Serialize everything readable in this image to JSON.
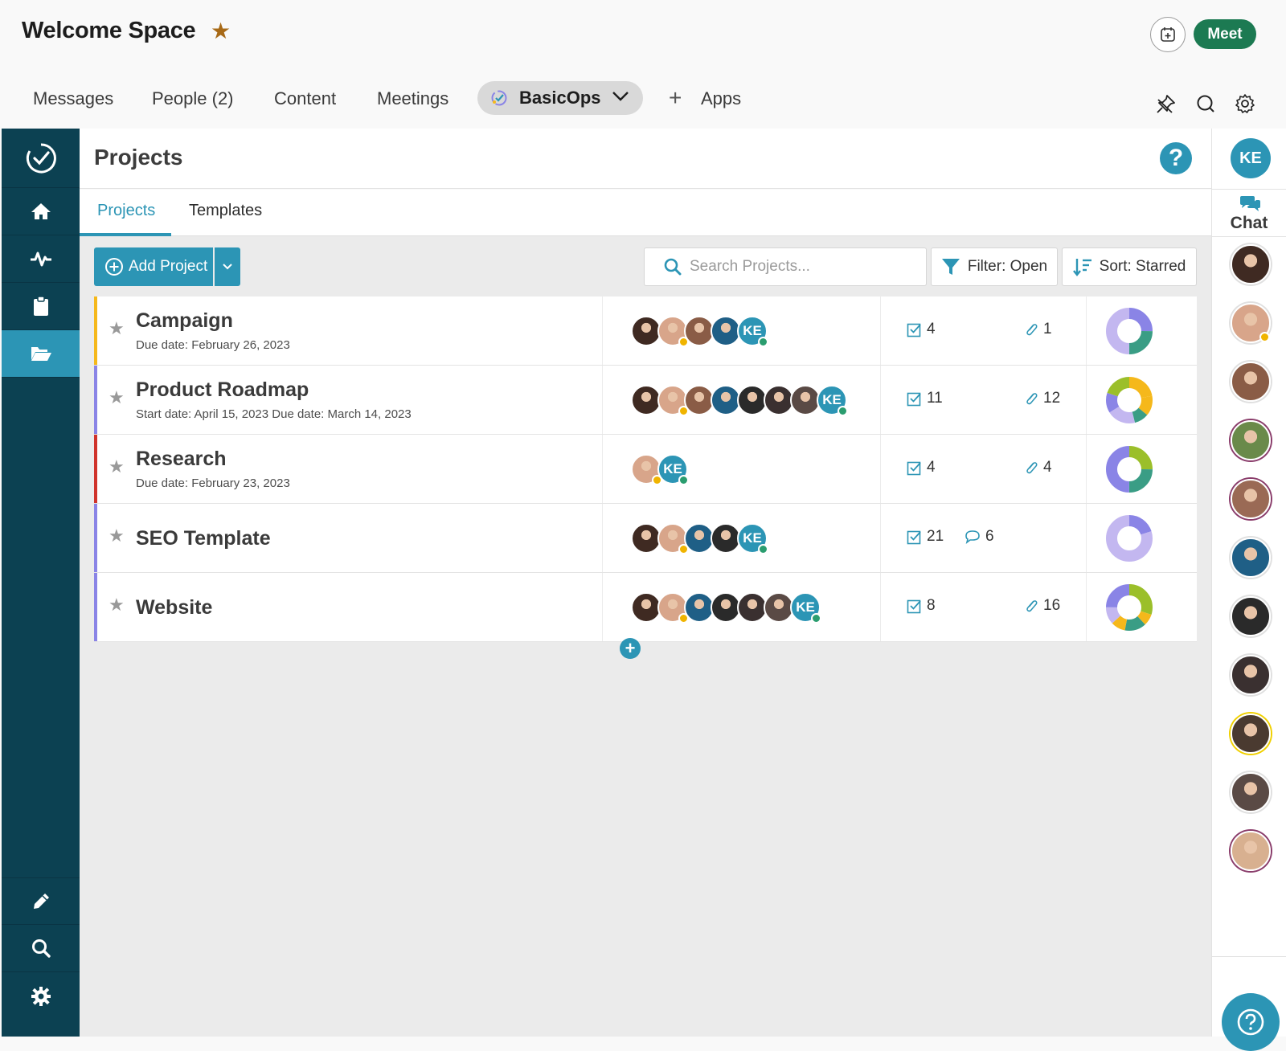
{
  "header": {
    "space_title": "Welcome Space",
    "meet_label": "Meet"
  },
  "nav": {
    "items": [
      "Messages",
      "People (2)",
      "Content",
      "Meetings"
    ],
    "active_app": "BasicOps",
    "apps_label": "Apps"
  },
  "main": {
    "title": "Projects",
    "tabs": [
      "Projects",
      "Templates"
    ],
    "active_tab": 0
  },
  "toolbar": {
    "add_label": "Add Project",
    "search_placeholder": "Search Projects...",
    "filter_label": "Filter: Open",
    "sort_label": "Sort: Starred"
  },
  "projects": [
    {
      "name": "Campaign",
      "date": "Due date: February 26, 2023",
      "accent": "#f5b81b",
      "members": [
        {
          "c": "#3f2a22",
          "s": "none"
        },
        {
          "c": "#d8a58a",
          "s": "away"
        },
        {
          "c": "#8a5c46",
          "s": "none"
        },
        {
          "c": "#1f5f86",
          "s": "none"
        },
        {
          "c": "ke",
          "s": "on"
        }
      ],
      "tasks": "4",
      "comments": "",
      "attachments": "1",
      "donut": [
        {
          "v": 0.25,
          "c": "#8a84e6"
        },
        {
          "v": 0.25,
          "c": "#3a9d85"
        },
        {
          "v": 0.5,
          "c": "#c3b7f0"
        }
      ]
    },
    {
      "name": "Product Roadmap",
      "date": "Start date: April 15, 2023 Due date: March 14, 2023",
      "accent": "#8a84e6",
      "members": [
        {
          "c": "#3f2a22",
          "s": "none"
        },
        {
          "c": "#d8a58a",
          "s": "away"
        },
        {
          "c": "#8a5c46",
          "s": "none"
        },
        {
          "c": "#1f5f86",
          "s": "none"
        },
        {
          "c": "#2a2a2a",
          "s": "none"
        },
        {
          "c": "#3a3030",
          "s": "none"
        },
        {
          "c": "#5a4a45",
          "s": "none"
        },
        {
          "c": "ke",
          "s": "on"
        }
      ],
      "tasks": "11",
      "comments": "",
      "attachments": "12",
      "donut": [
        {
          "v": 0.22,
          "c": "#f5b81b"
        },
        {
          "v": 0.14,
          "c": "#f5b81b"
        },
        {
          "v": 0.1,
          "c": "#3a9d85"
        },
        {
          "v": 0.2,
          "c": "#c3b7f0"
        },
        {
          "v": 0.14,
          "c": "#8a84e6"
        },
        {
          "v": 0.2,
          "c": "#9bbf2a"
        }
      ]
    },
    {
      "name": "Research",
      "date": "Due date: February 23, 2023",
      "accent": "#d0332b",
      "members": [
        {
          "c": "#d8a58a",
          "s": "away"
        },
        {
          "c": "ke",
          "s": "on"
        }
      ],
      "tasks": "4",
      "comments": "",
      "attachments": "4",
      "donut": [
        {
          "v": 0.25,
          "c": "#9bbf2a"
        },
        {
          "v": 0.25,
          "c": "#3a9d85"
        },
        {
          "v": 0.5,
          "c": "#8a84e6"
        }
      ]
    },
    {
      "name": "SEO Template",
      "date": "",
      "accent": "#8a84e6",
      "members": [
        {
          "c": "#3f2a22",
          "s": "none"
        },
        {
          "c": "#d8a58a",
          "s": "away"
        },
        {
          "c": "#1f5f86",
          "s": "none"
        },
        {
          "c": "#2a2a2a",
          "s": "none"
        },
        {
          "c": "ke",
          "s": "on"
        }
      ],
      "tasks": "21",
      "comments": "6",
      "attachments": "",
      "donut": [
        {
          "v": 0.2,
          "c": "#8a84e6"
        },
        {
          "v": 0.8,
          "c": "#c3b7f0"
        }
      ]
    },
    {
      "name": "Website",
      "date": "",
      "accent": "#8a84e6",
      "members": [
        {
          "c": "#3f2a22",
          "s": "none"
        },
        {
          "c": "#d8a58a",
          "s": "away"
        },
        {
          "c": "#1f5f86",
          "s": "none"
        },
        {
          "c": "#2a2a2a",
          "s": "none"
        },
        {
          "c": "#3a3030",
          "s": "none"
        },
        {
          "c": "#5a4a45",
          "s": "none"
        },
        {
          "c": "ke",
          "s": "on"
        }
      ],
      "tasks": "8",
      "comments": "",
      "attachments": "16",
      "donut": [
        {
          "v": 0.3,
          "c": "#9bbf2a"
        },
        {
          "v": 0.08,
          "c": "#f5b81b"
        },
        {
          "v": 0.15,
          "c": "#3a9d85"
        },
        {
          "v": 0.1,
          "c": "#f5b81b"
        },
        {
          "v": 0.12,
          "c": "#c3b7f0"
        },
        {
          "v": 0.25,
          "c": "#8a84e6"
        }
      ]
    }
  ],
  "user": {
    "initials": "KE"
  },
  "chat": {
    "label": "Chat",
    "contacts": [
      {
        "c": "#3f2a22",
        "ring": "#e0e0e0",
        "s": "none"
      },
      {
        "c": "#d8a58a",
        "ring": "#e0e0e0",
        "s": "away"
      },
      {
        "c": "#8a5c46",
        "ring": "#e0e0e0",
        "s": "none"
      },
      {
        "c": "#6a8a4a",
        "ring": "#8a3d6b",
        "s": "none"
      },
      {
        "c": "#9a6a55",
        "ring": "#8a3d6b",
        "s": "none"
      },
      {
        "c": "#1f5f86",
        "ring": "#e0e0e0",
        "s": "none"
      },
      {
        "c": "#2a2a2a",
        "ring": "#e0e0e0",
        "s": "none"
      },
      {
        "c": "#3a3030",
        "ring": "#e0e0e0",
        "s": "none"
      },
      {
        "c": "#4a3a30",
        "ring": "#f0d000",
        "s": "none"
      },
      {
        "c": "#5a4a45",
        "ring": "#e0e0e0",
        "s": "none"
      },
      {
        "c": "#d8b090",
        "ring": "#8a3d6b",
        "s": "none"
      }
    ]
  },
  "colors": {
    "accent": "#2c95b5",
    "sidebar": "#0c4152",
    "meet": "#1c7a52"
  }
}
